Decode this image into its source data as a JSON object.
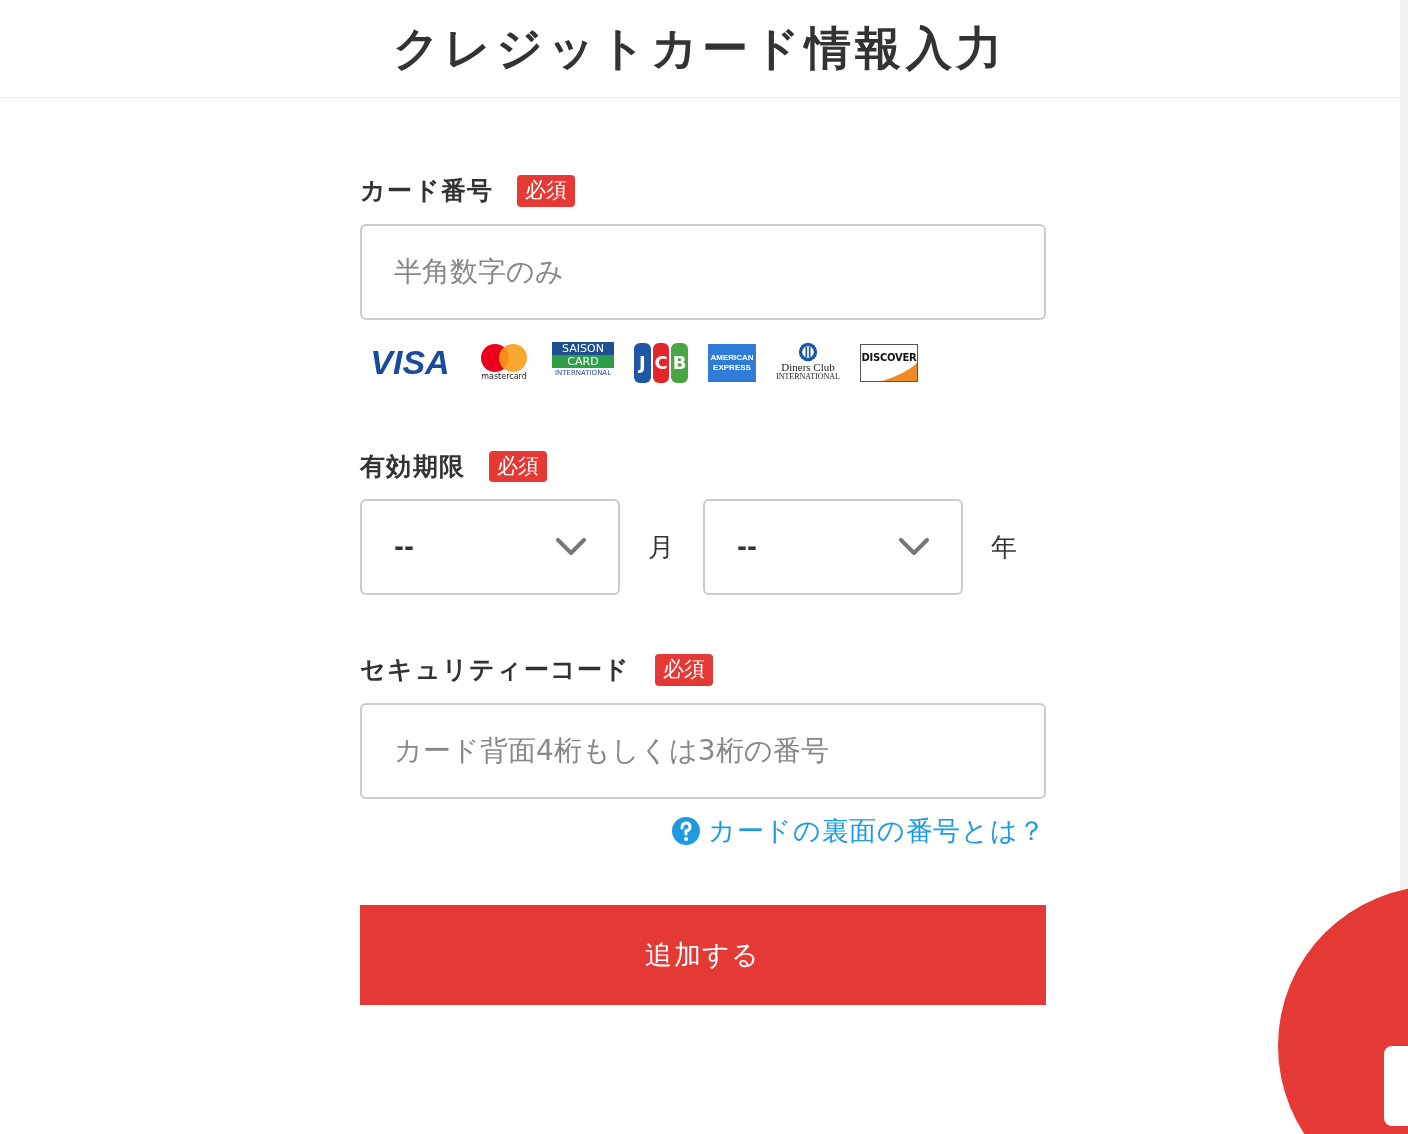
{
  "title": "クレジットカード情報入力",
  "card_number": {
    "label": "カード番号",
    "badge": "必須",
    "placeholder": "半角数字のみ"
  },
  "brands": [
    {
      "kind": "visa",
      "texts": [
        "VISA"
      ]
    },
    {
      "kind": "mastercard",
      "texts": [
        "mastercard"
      ]
    },
    {
      "kind": "saison",
      "texts": [
        "SAISON",
        "CARD",
        "INTERNATIONAL"
      ]
    },
    {
      "kind": "jcb",
      "texts": [
        "J",
        "C",
        "B"
      ]
    },
    {
      "kind": "amex",
      "texts": [
        "AMERICAN",
        "EXPRESS"
      ]
    },
    {
      "kind": "diners",
      "texts": [
        "Diners Club",
        "INTERNATIONAL"
      ]
    },
    {
      "kind": "discover",
      "texts": [
        "DISCOVER"
      ]
    }
  ],
  "expiry": {
    "label": "有効期限",
    "badge": "必須",
    "month": {
      "value": "--",
      "unit": "月"
    },
    "year": {
      "value": "--",
      "unit": "年"
    }
  },
  "security_code": {
    "label": "セキュリティーコード",
    "badge": "必須",
    "placeholder": "カード背面4桁もしくは3桁の番号",
    "help_link": "カードの裏面の番号とは？"
  },
  "submit": "追加する"
}
